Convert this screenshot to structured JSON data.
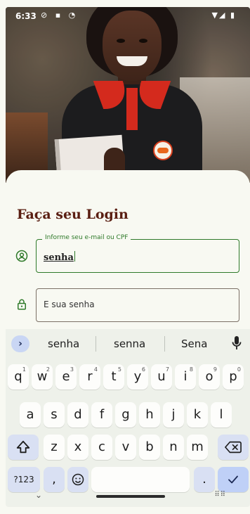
{
  "status_bar": {
    "time": "6:33",
    "left_icons": "⊘ ▪ ◔",
    "right_icons": "▼◢ ▮"
  },
  "login": {
    "title": "Faça seu Login",
    "email_field": {
      "label": "Informe seu e-mail ou CPF",
      "value": "senha"
    },
    "password_field": {
      "placeholder": "E sua senha"
    }
  },
  "keyboard": {
    "suggestions": [
      "senha",
      "senna",
      "Sena"
    ],
    "row1": [
      {
        "k": "q",
        "n": "1"
      },
      {
        "k": "w",
        "n": "2"
      },
      {
        "k": "e",
        "n": "3"
      },
      {
        "k": "r",
        "n": "4"
      },
      {
        "k": "t",
        "n": "5"
      },
      {
        "k": "y",
        "n": "6"
      },
      {
        "k": "u",
        "n": "7"
      },
      {
        "k": "i",
        "n": "8"
      },
      {
        "k": "o",
        "n": "9"
      },
      {
        "k": "p",
        "n": "0"
      }
    ],
    "row2": [
      "a",
      "s",
      "d",
      "f",
      "g",
      "h",
      "j",
      "k",
      "l"
    ],
    "row3": [
      "z",
      "x",
      "c",
      "v",
      "b",
      "n",
      "m"
    ],
    "symbols_label": "?123",
    "comma": ",",
    "period": "."
  },
  "colors": {
    "accent_green": "#2f7a2a",
    "title_brown": "#5a1e12",
    "brand_red": "#d42a1d"
  }
}
